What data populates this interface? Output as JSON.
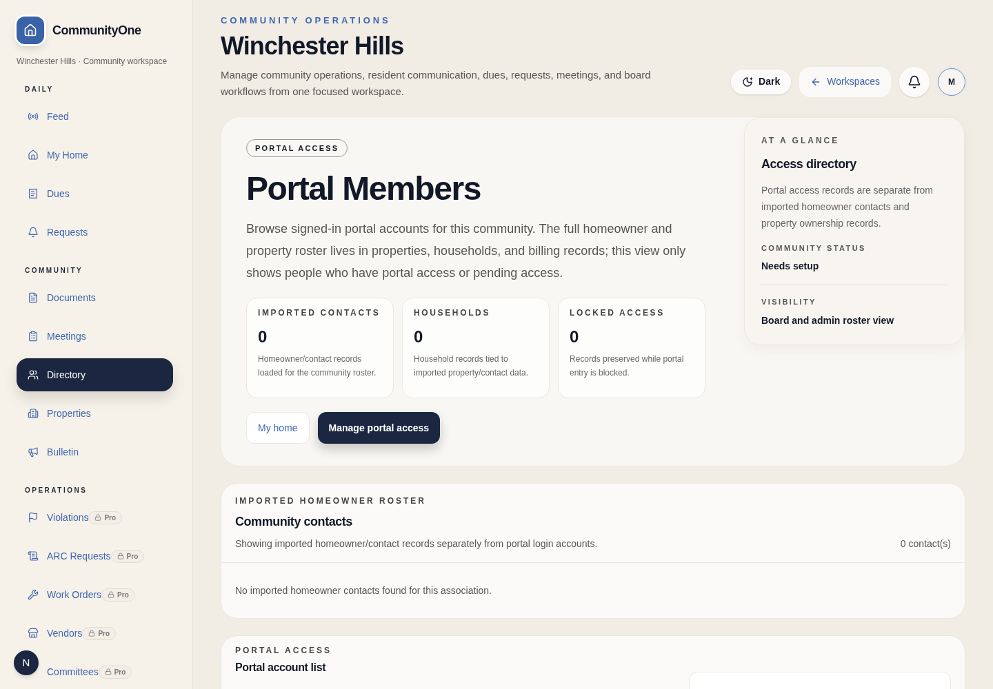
{
  "brand": {
    "name": "CommunityOne",
    "subtitle": "Winchester Hills · Community workspace"
  },
  "sidebar": {
    "sections": [
      {
        "title": "DAILY",
        "items": [
          {
            "label": "Feed",
            "selected": false
          },
          {
            "label": "My Home",
            "selected": false
          },
          {
            "label": "Dues",
            "selected": false
          },
          {
            "label": "Requests",
            "selected": false
          }
        ]
      },
      {
        "title": "COMMUNITY",
        "items": [
          {
            "label": "Documents",
            "selected": false
          },
          {
            "label": "Meetings",
            "selected": false
          },
          {
            "label": "Directory",
            "selected": true
          },
          {
            "label": "Properties",
            "selected": false
          },
          {
            "label": "Bulletin",
            "selected": false
          }
        ]
      },
      {
        "title": "OPERATIONS",
        "items": [
          {
            "label": "Violations",
            "selected": false,
            "badge": "Pro"
          },
          {
            "label": "ARC Requests",
            "selected": false,
            "badge": "Pro"
          },
          {
            "label": "Work Orders",
            "selected": false,
            "badge": "Pro"
          },
          {
            "label": "Vendors",
            "selected": false,
            "badge": "Pro"
          },
          {
            "label": "Committees",
            "selected": false,
            "badge": "Pro"
          }
        ]
      }
    ]
  },
  "floating_badge": "N",
  "header": {
    "eyebrow": "COMMUNITY OPERATIONS",
    "title": "Winchester Hills",
    "description": "Manage community operations, resident communication, dues, requests, meetings, and board workflows from one focused workspace.",
    "theme_button": "Dark",
    "workspaces_button": "Workspaces",
    "avatar": "M"
  },
  "hero": {
    "tag": "PORTAL ACCESS",
    "title": "Portal Members",
    "description": "Browse signed-in portal accounts for this community. The full homeowner and property roster lives in properties, households, and billing records; this view only shows people who have portal access or pending access.",
    "stats": [
      {
        "label": "IMPORTED CONTACTS",
        "value": "0",
        "note": "Homeowner/contact records loaded for the community roster."
      },
      {
        "label": "HOUSEHOLDS",
        "value": "0",
        "note": "Household records tied to imported property/contact data."
      },
      {
        "label": "LOCKED ACCESS",
        "value": "0",
        "note": "Records preserved while portal entry is blocked."
      }
    ],
    "buttons": [
      {
        "label": "My home",
        "kind": "secondary"
      },
      {
        "label": "Manage portal access",
        "kind": "primary"
      }
    ]
  },
  "glance": {
    "eyebrow": "AT A GLANCE",
    "title": "Access directory",
    "description": "Portal access records are separate from imported homeowner contacts and property ownership records.",
    "facts": [
      {
        "label": "COMMUNITY STATUS",
        "value": "Needs setup"
      },
      {
        "label": "VISIBILITY",
        "value": "Board and admin roster view"
      }
    ]
  },
  "contacts": {
    "eyebrow": "IMPORTED HOMEOWNER ROSTER",
    "title": "Community contacts",
    "description": "Showing imported homeowner/contact records separately from portal login accounts.",
    "count": "0 contact(s)",
    "empty": "No imported homeowner contacts found for this association."
  },
  "accounts": {
    "eyebrow": "PORTAL ACCESS",
    "title": "Portal account list"
  }
}
